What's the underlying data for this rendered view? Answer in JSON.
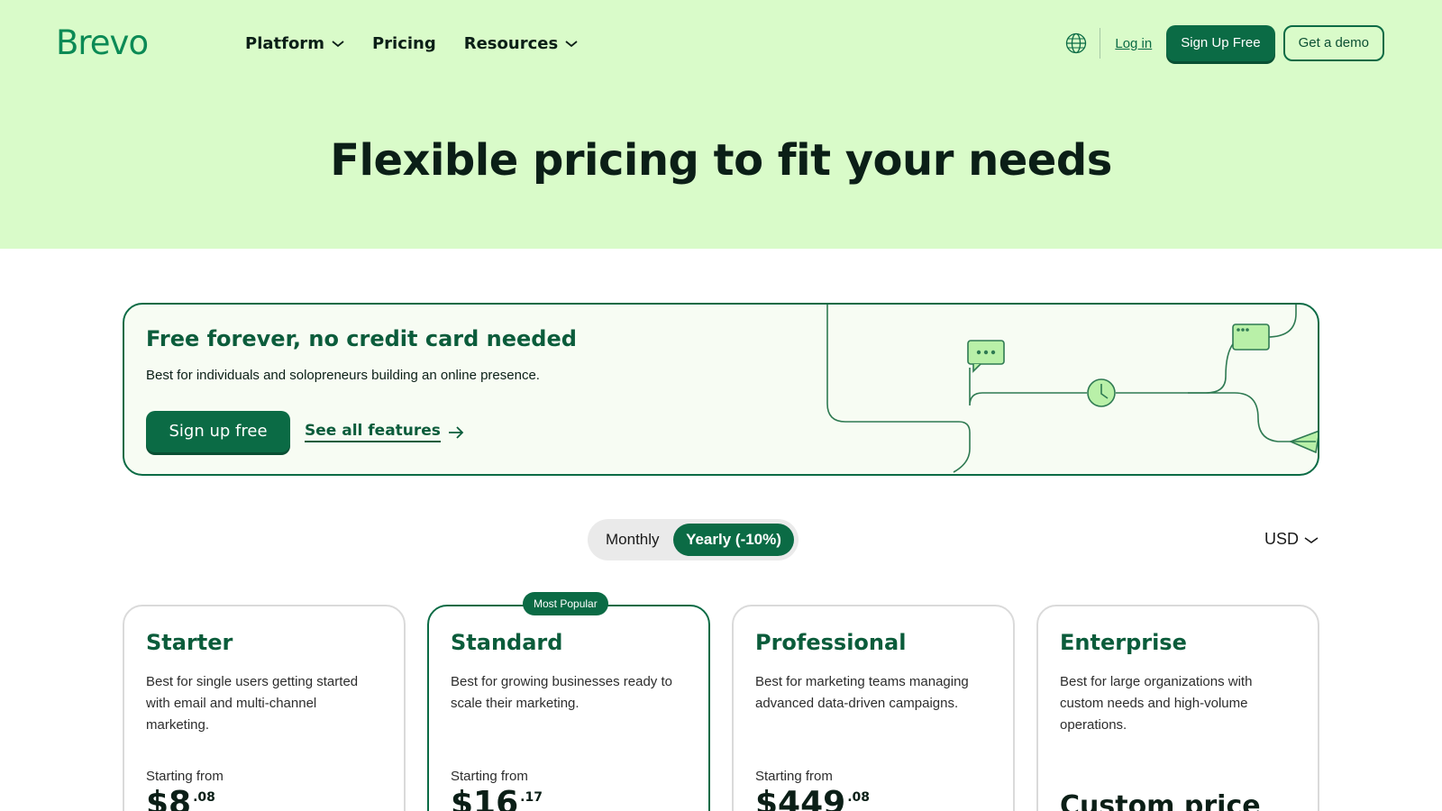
{
  "header": {
    "logo": "Brevo",
    "nav": [
      {
        "label": "Platform",
        "has_dropdown": true
      },
      {
        "label": "Pricing",
        "has_dropdown": false
      },
      {
        "label": "Resources",
        "has_dropdown": true
      }
    ],
    "language_icon": "globe-icon",
    "login": "Log in",
    "signup": "Sign Up Free",
    "demo": "Get a demo"
  },
  "hero": {
    "title": "Flexible pricing to fit your needs"
  },
  "free_plan": {
    "title": "Free forever, no credit card needed",
    "description": "Best for individuals and solopreneurs building an online presence.",
    "cta": "Sign up free",
    "link": "See all features"
  },
  "billing": {
    "monthly": "Monthly",
    "yearly": "Yearly (-10%)",
    "selected": "Yearly (-10%)",
    "currency": "USD"
  },
  "plans": [
    {
      "name": "Starter",
      "description": "Best for single users getting started with email and multi-channel marketing.",
      "starting_label": "Starting from",
      "price_main": "$8",
      "price_cents": ".08"
    },
    {
      "name": "Standard",
      "badge": "Most Popular",
      "description": "Best for growing businesses ready to scale their marketing.",
      "starting_label": "Starting from",
      "price_main": "$16",
      "price_cents": ".17"
    },
    {
      "name": "Professional",
      "description": "Best for marketing teams managing advanced data-driven campaigns.",
      "starting_label": "Starting from",
      "price_main": "$449",
      "price_cents": ".08"
    },
    {
      "name": "Enterprise",
      "description": "Best for large organizations with custom needs and high-volume operations.",
      "price_custom": "Custom price"
    }
  ],
  "colors": {
    "hero_bg": "#d9fbc9",
    "brand_green": "#0b6b45",
    "heading_green": "#0b5c3b"
  }
}
